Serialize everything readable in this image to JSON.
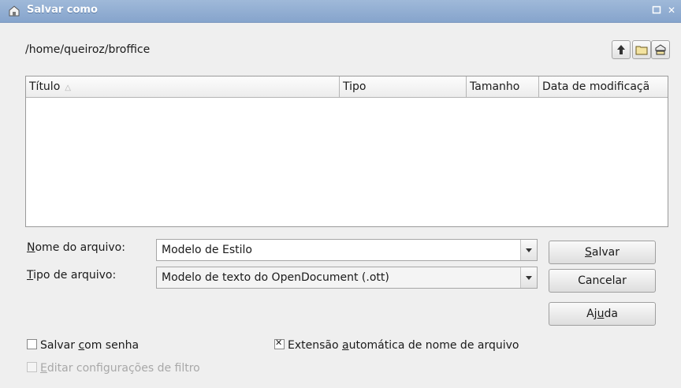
{
  "window": {
    "title": "Salvar como"
  },
  "location": {
    "path": "/home/queiroz/broffice"
  },
  "toolbar": {
    "up_icon": "folder-up-icon",
    "new_folder_icon": "new-folder-icon",
    "default_dir_icon": "default-directory-icon"
  },
  "file_list": {
    "columns": [
      {
        "label": "Título",
        "sorted": "ascending"
      },
      {
        "label": "Tipo"
      },
      {
        "label": "Tamanho"
      },
      {
        "label": "Data de modificaçã"
      }
    ],
    "rows": []
  },
  "form": {
    "filename_label_key": "N",
    "filename_label_rest": "ome do arquivo:",
    "filename_value": "Modelo de Estilo",
    "filetype_label_key": "T",
    "filetype_label_rest": "ipo de arquivo:",
    "filetype_value": "Modelo de texto do OpenDocument (.ott)"
  },
  "buttons": {
    "save_key": "S",
    "save_rest": "alvar",
    "cancel": "Cancelar",
    "help_pre": "Aj",
    "help_key": "u",
    "help_rest": "da"
  },
  "options": {
    "password_pre": "Salvar ",
    "password_key": "c",
    "password_rest": "om senha",
    "password_checked": false,
    "ext_pre": "Extensão ",
    "ext_key": "a",
    "ext_rest": "utomática de nome de arquivo",
    "ext_checked": true,
    "filter_key": "E",
    "filter_rest": "ditar configurações de filtro",
    "filter_checked": false,
    "filter_enabled": false
  }
}
